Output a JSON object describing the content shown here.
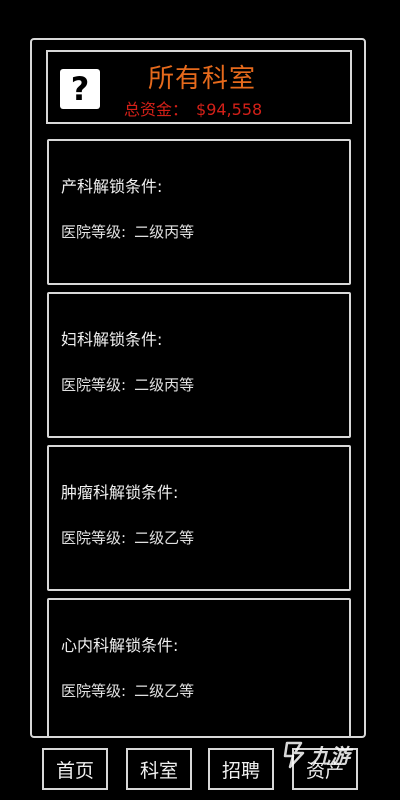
{
  "header": {
    "help_label": "?",
    "title": "所有科室",
    "funds_label": "总资金：",
    "funds_value": "$94,558"
  },
  "departments": [
    {
      "name": "产科解锁条件:",
      "req_label": "医院等级:",
      "req_value": "二级丙等"
    },
    {
      "name": "妇科解锁条件:",
      "req_label": "医院等级:",
      "req_value": "二级丙等"
    },
    {
      "name": "肿瘤科解锁条件:",
      "req_label": "医院等级:",
      "req_value": "二级乙等"
    },
    {
      "name": "心内科解锁条件:",
      "req_label": "医院等级:",
      "req_value": "二级乙等"
    }
  ],
  "nav": {
    "home": "首页",
    "departments": "科室",
    "recruit": "招聘",
    "assets": "资产"
  },
  "watermark": {
    "icon": "jiuyou-logo-icon",
    "text": "九游"
  }
}
